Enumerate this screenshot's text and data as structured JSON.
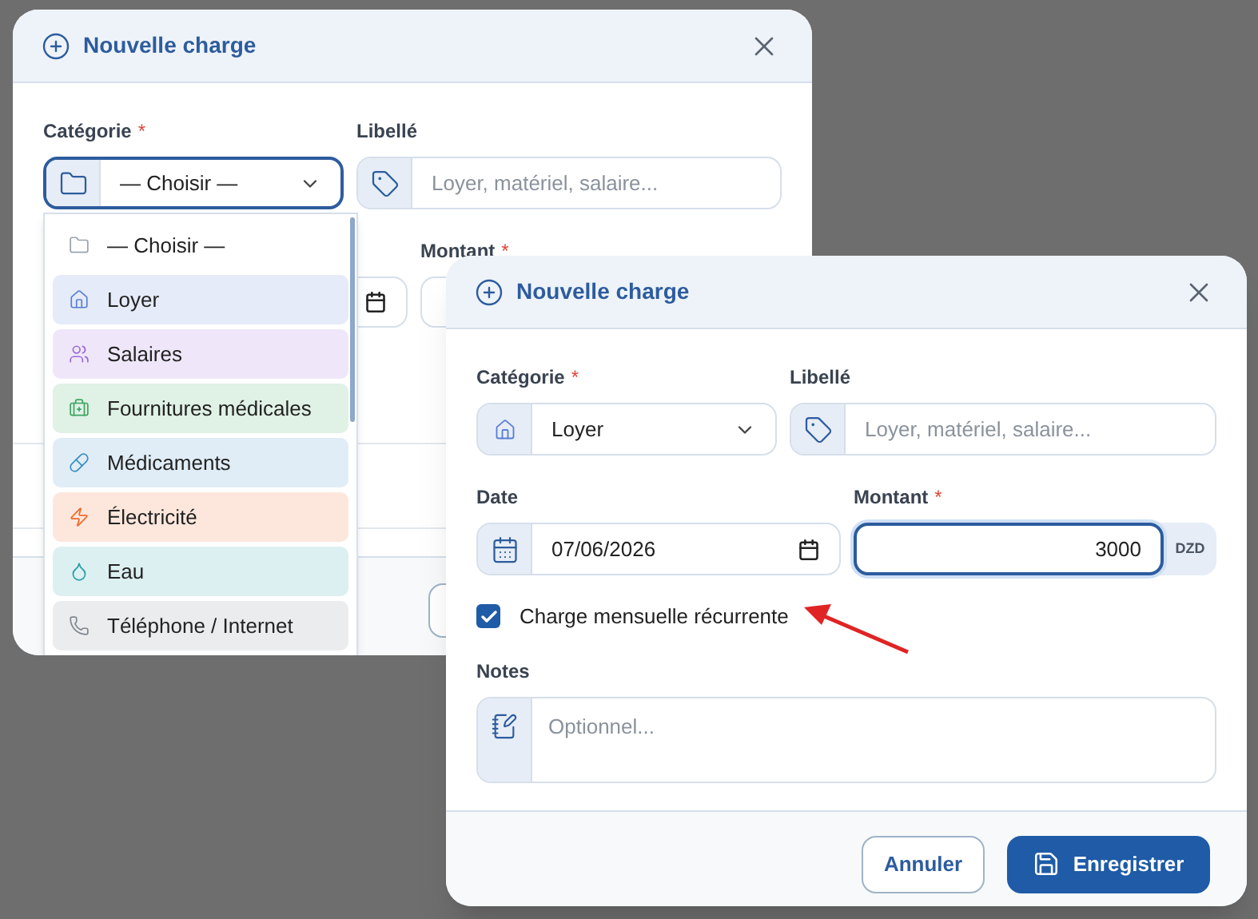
{
  "back_dialog": {
    "title": "Nouvelle charge",
    "category": {
      "label": "Catégorie",
      "required_mark": "*",
      "value": "— Choisir —"
    },
    "libelle": {
      "label": "Libellé",
      "placeholder": "Loyer, matériel, salaire..."
    },
    "montant": {
      "label": "Montant",
      "required_mark": "*"
    },
    "dropdown": {
      "items": [
        {
          "label": "— Choisir —",
          "kind": "folder",
          "color": "#9aa3ad",
          "selected": true
        },
        {
          "label": "Loyer",
          "kind": "home",
          "color": "#5b7fd6",
          "selected": false
        },
        {
          "label": "Salaires",
          "kind": "users",
          "color": "#9b6ad8",
          "selected": false
        },
        {
          "label": "Fournitures médicales",
          "kind": "kit",
          "color": "#3fa561",
          "selected": false
        },
        {
          "label": "Médicaments",
          "kind": "pill",
          "color": "#3b8fc4",
          "selected": false
        },
        {
          "label": "Électricité",
          "kind": "zap",
          "color": "#f06a2b",
          "selected": false
        },
        {
          "label": "Eau",
          "kind": "drop",
          "color": "#2aa0a8",
          "selected": false
        },
        {
          "label": "Téléphone / Internet",
          "kind": "phone",
          "color": "#808891",
          "selected": false
        }
      ]
    }
  },
  "front_dialog": {
    "title": "Nouvelle charge",
    "category": {
      "label": "Catégorie",
      "required_mark": "*",
      "value": "Loyer"
    },
    "libelle": {
      "label": "Libellé",
      "placeholder": "Loyer, matériel, salaire..."
    },
    "date": {
      "label": "Date",
      "value": "07/06/2026"
    },
    "montant": {
      "label": "Montant",
      "required_mark": "*",
      "value": "3000",
      "currency": "DZD"
    },
    "recurring": {
      "label": "Charge mensuelle récurrente",
      "checked": true
    },
    "notes": {
      "label": "Notes",
      "placeholder": "Optionnel..."
    },
    "buttons": {
      "cancel": "Annuler",
      "save": "Enregistrer"
    }
  }
}
